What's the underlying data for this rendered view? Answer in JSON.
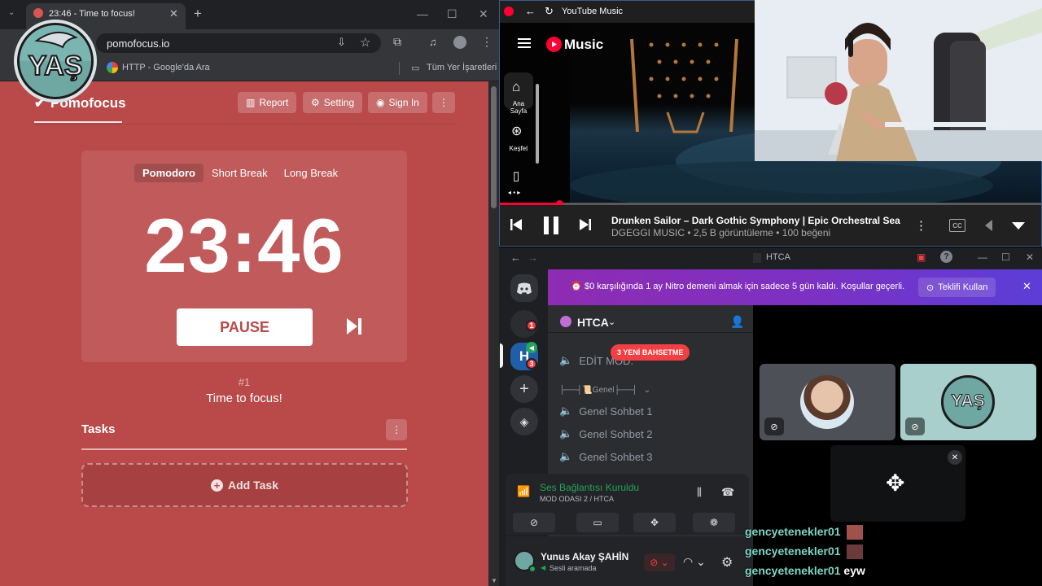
{
  "browser": {
    "tab_title": "23:46 - Time to focus!",
    "url": "pomofocus.io",
    "bookmark_google": "HTTP - Google'da Ara",
    "bookmark_all": "Tüm Yer İşaretleri"
  },
  "pomofocus": {
    "logo": "Pomofocus",
    "report": "Report",
    "setting": "Setting",
    "signin": "Sign In",
    "modes": [
      "Pomodoro",
      "Short Break",
      "Long Break"
    ],
    "timer": "23:46",
    "pause": "PAUSE",
    "count": "#1",
    "message": "Time to focus!",
    "tasks": "Tasks",
    "add_task": "Add Task"
  },
  "overlay": {
    "logo_text": "YAŞ"
  },
  "ytmusic": {
    "window_title": "YouTube Music",
    "brand": "Music",
    "nav": [
      "Ana Sayfa",
      "Keşfet"
    ],
    "song_title": "Drunken Sailor – Dark Gothic Symphony | Epic Orchestral Sea Sha...",
    "song_meta": "DGEGGI MUSIC • 2,5 B görüntüleme • 100 beğeni",
    "progress": 0.11
  },
  "discord": {
    "window_title": "HTCA",
    "banner": "$0 karşılığında 1 ay Nitro demeni almak için sadece 5 gün kaldı. Koşullar geçerli.",
    "banner_button": "Teklifi Kullan",
    "server_name": "HTCA",
    "server_badges": [
      "1",
      "3"
    ],
    "mention_pill": "3 YENİ BAHSETME",
    "channel_edit": "EDİT MOD.",
    "category": "├──┤📜Genel├──┤",
    "channels": [
      "Genel Sohbet 1",
      "Genel Sohbet 2",
      "Genel Sohbet 3"
    ],
    "voice_status": "Ses Bağlantısı Kuruldu",
    "voice_channel": "MOD ODASI 2 / HTCA",
    "user_name": "Yunus Akay ŞAHİN",
    "user_status": "Sesli aramada",
    "tile_logo": "YAŞ"
  },
  "chat": [
    {
      "user": "gencyetenekler01",
      "msg": ""
    },
    {
      "user": "gencyetenekler01",
      "msg": ""
    },
    {
      "user": "gencyetenekler01",
      "msg": "eyw"
    }
  ]
}
